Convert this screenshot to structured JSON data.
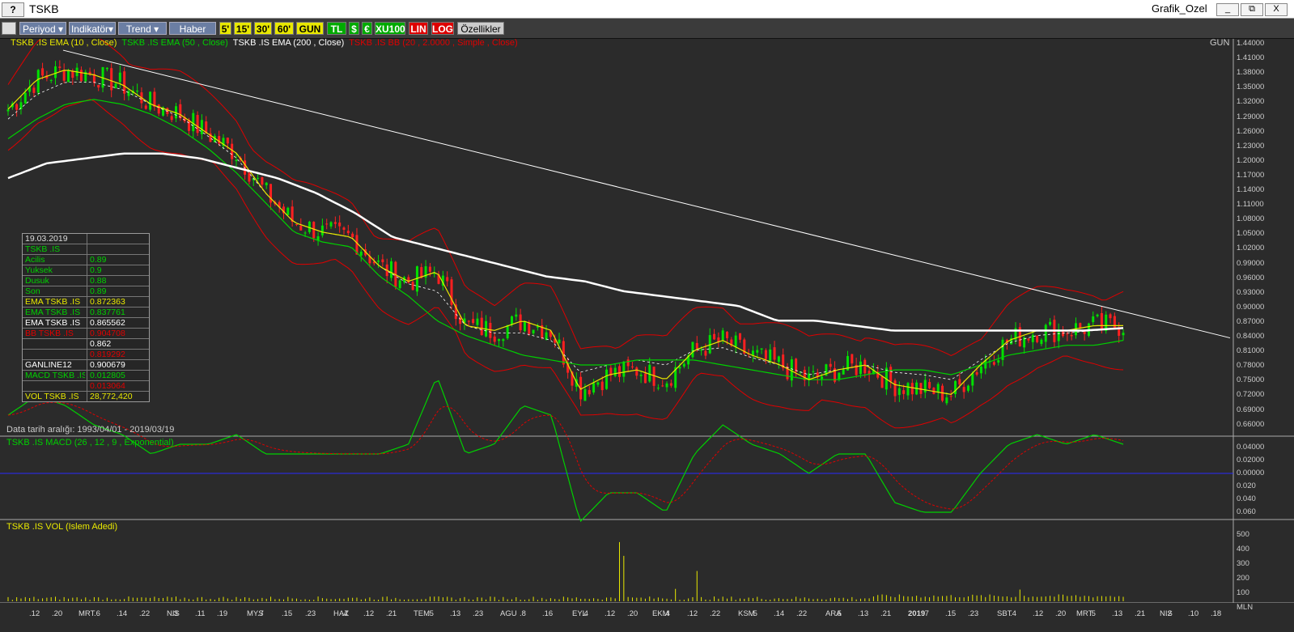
{
  "window": {
    "help_label": "?",
    "symbol": "TSKB",
    "title": "Grafik_Ozel",
    "min_label": "_",
    "restore_label": "⧉",
    "close_label": "X"
  },
  "toolbar": {
    "menus": [
      "Periyod",
      "Indikatör",
      "Trend",
      "Haber"
    ],
    "periods": [
      "5'",
      "15'",
      "30'",
      "60'",
      "GUN"
    ],
    "currencies": [
      "TL",
      "$",
      "€",
      "XU100"
    ],
    "scales": [
      "LIN",
      "LOG"
    ],
    "properties": "Özellikler"
  },
  "price_panel": {
    "legend": [
      {
        "text": "TSKB .IS EMA (10 , Close)",
        "color": "#e8e800"
      },
      {
        "text": "TSKB .IS EMA (50 , Close)",
        "color": "#00d000"
      },
      {
        "text": "TSKB .IS EMA (200 , Close)",
        "color": "#ffffff"
      },
      {
        "text": "TSKB .IS BB (20 , 2.0000 , Simple , Close)",
        "color": "#e00000"
      }
    ],
    "period_label": "GUN",
    "range_note": "Data tarih aralığı: 1993/04/01 - 2019/03/19",
    "y_ticks": [
      "1.44000",
      "1.41000",
      "1.38000",
      "1.35000",
      "1.32000",
      "1.29000",
      "1.26000",
      "1.23000",
      "1.20000",
      "1.17000",
      "1.14000",
      "1.11000",
      "1.08000",
      "1.05000",
      "1.02000",
      "0.99000",
      "0.96000",
      "0.93000",
      "0.90000",
      "0.87000",
      "0.84000",
      "0.81000",
      "0.78000",
      "0.75000",
      "0.72000",
      "0.69000",
      "0.66000"
    ]
  },
  "info_box": {
    "date": "19.03.2019",
    "symbol": "TSKB .IS",
    "rows": [
      {
        "label": "Acilis",
        "value": "0.89",
        "lc": "#00d000",
        "vc": "#00d000"
      },
      {
        "label": "Yuksek",
        "value": "0.9",
        "lc": "#00d000",
        "vc": "#00d000"
      },
      {
        "label": "Dusuk",
        "value": "0.88",
        "lc": "#00d000",
        "vc": "#00d000"
      },
      {
        "label": "Son",
        "value": "0.89",
        "lc": "#00d000",
        "vc": "#00d000"
      },
      {
        "label": "EMA TSKB .IS",
        "value": "0.872363",
        "lc": "#e8e800",
        "vc": "#e8e800"
      },
      {
        "label": "EMA TSKB .IS",
        "value": "0.837761",
        "lc": "#00d000",
        "vc": "#00d000"
      },
      {
        "label": "EMA TSKB .IS",
        "value": "0.865562",
        "lc": "#ffffff",
        "vc": "#ffffff"
      },
      {
        "label": "BB TSKB .IS",
        "value": "0.904708",
        "lc": "#e00000",
        "vc": "#e00000"
      },
      {
        "label": "",
        "value": "0.862",
        "lc": "#ffffff",
        "vc": "#ffffff"
      },
      {
        "label": "",
        "value": "0.819292",
        "lc": "#e00000",
        "vc": "#e00000"
      },
      {
        "label": "GANLINE12",
        "value": "0.900679",
        "lc": "#ffffff",
        "vc": "#ffffff"
      },
      {
        "label": "MACD TSKB .IS",
        "value": "0.012805",
        "lc": "#00d000",
        "vc": "#00d000"
      },
      {
        "label": "",
        "value": "0.013064",
        "lc": "#e00000",
        "vc": "#e00000"
      },
      {
        "label": "VOL TSKB .IS",
        "value": "28,772,420",
        "lc": "#e8e800",
        "vc": "#e8e800"
      }
    ]
  },
  "macd_panel": {
    "legend": "TSKB .IS MACD (26 , 12 , 9 , Exponential)",
    "y_ticks": [
      "0.04000",
      "0.02000",
      "0.00000",
      "0.020",
      "0.040",
      "0.060"
    ]
  },
  "volume_panel": {
    "legend": "TSKB .IS VOL (Islem Adedi)",
    "y_ticks": [
      "500",
      "400",
      "300",
      "200",
      "100",
      "MLN"
    ]
  },
  "x_axis": [
    {
      "t": ".12",
      "bold": false
    },
    {
      "t": ".20",
      "bold": false
    },
    {
      "t": "MRT",
      "bold": false
    },
    {
      "t": ".6",
      "bold": false
    },
    {
      "t": ".14",
      "bold": false
    },
    {
      "t": ".22",
      "bold": false
    },
    {
      "t": "NIS",
      "bold": false
    },
    {
      "t": ".3",
      "bold": false
    },
    {
      "t": ".11",
      "bold": false
    },
    {
      "t": ".19",
      "bold": false
    },
    {
      "t": "MYS",
      "bold": false
    },
    {
      "t": ".7",
      "bold": false
    },
    {
      "t": ".15",
      "bold": false
    },
    {
      "t": ".23",
      "bold": false
    },
    {
      "t": "HAZ",
      "bold": false
    },
    {
      "t": ".4",
      "bold": false
    },
    {
      "t": ".12",
      "bold": false
    },
    {
      "t": ".21",
      "bold": false
    },
    {
      "t": "TEM",
      "bold": false
    },
    {
      "t": ".5",
      "bold": false
    },
    {
      "t": ".13",
      "bold": false
    },
    {
      "t": ".23",
      "bold": false
    },
    {
      "t": "AGU",
      "bold": false
    },
    {
      "t": ".8",
      "bold": false
    },
    {
      "t": ".16",
      "bold": false
    },
    {
      "t": "EYL",
      "bold": false
    },
    {
      "t": ".4",
      "bold": false
    },
    {
      "t": ".12",
      "bold": false
    },
    {
      "t": ".20",
      "bold": false
    },
    {
      "t": "EKM",
      "bold": false
    },
    {
      "t": ".4",
      "bold": false
    },
    {
      "t": ".12",
      "bold": false
    },
    {
      "t": ".22",
      "bold": false
    },
    {
      "t": "KSM",
      "bold": false
    },
    {
      "t": ".5",
      "bold": false
    },
    {
      "t": ".14",
      "bold": false
    },
    {
      "t": ".22",
      "bold": false
    },
    {
      "t": "ARA",
      "bold": false
    },
    {
      "t": ".5",
      "bold": false
    },
    {
      "t": ".13",
      "bold": false
    },
    {
      "t": ".21",
      "bold": false
    },
    {
      "t": "2019",
      "bold": true
    },
    {
      "t": ".7",
      "bold": false
    },
    {
      "t": ".15",
      "bold": false
    },
    {
      "t": ".23",
      "bold": false
    },
    {
      "t": "SBT",
      "bold": false
    },
    {
      "t": ".4",
      "bold": false
    },
    {
      "t": ".12",
      "bold": false
    },
    {
      "t": ".20",
      "bold": false
    },
    {
      "t": "MRT",
      "bold": false
    },
    {
      "t": ".5",
      "bold": false
    },
    {
      "t": ".13",
      "bold": false
    },
    {
      "t": ".21",
      "bold": false
    },
    {
      "t": "NIS",
      "bold": false
    },
    {
      "t": ".2",
      "bold": false
    },
    {
      "t": ".10",
      "bold": false
    },
    {
      "t": ".18",
      "bold": false
    }
  ],
  "chart_data": {
    "type": "line",
    "title": "TSKB",
    "series": [
      {
        "name": "TSKB .IS EMA (10 , Close)",
        "color": "#e8e800",
        "values": [
          1.31,
          1.37,
          1.39,
          1.38,
          1.36,
          1.32,
          1.3,
          1.26,
          1.22,
          1.14,
          1.08,
          1.06,
          1.05,
          0.99,
          0.96,
          0.98,
          0.87,
          0.86,
          0.88,
          0.86,
          0.74,
          0.77,
          0.78,
          0.76,
          0.82,
          0.84,
          0.81,
          0.79,
          0.76,
          0.78,
          0.79,
          0.75,
          0.74,
          0.73,
          0.79,
          0.84,
          0.86,
          0.86,
          0.87,
          0.87
        ]
      },
      {
        "name": "TSKB .IS EMA (50 , Close)",
        "color": "#00d000",
        "values": [
          1.25,
          1.29,
          1.32,
          1.33,
          1.32,
          1.3,
          1.27,
          1.23,
          1.18,
          1.12,
          1.06,
          1.04,
          1.03,
          0.97,
          0.93,
          0.88,
          0.85,
          0.83,
          0.81,
          0.8,
          0.79,
          0.79,
          0.8,
          0.8,
          0.8,
          0.79,
          0.78,
          0.77,
          0.76,
          0.76,
          0.77,
          0.78,
          0.78,
          0.77,
          0.79,
          0.81,
          0.82,
          0.83,
          0.83,
          0.84
        ]
      },
      {
        "name": "TSKB .IS EMA (200 , Close)",
        "color": "#ffffff",
        "values": [
          1.17,
          1.2,
          1.21,
          1.22,
          1.22,
          1.21,
          1.19,
          1.17,
          1.14,
          1.1,
          1.05,
          1.03,
          1.01,
          0.99,
          0.97,
          0.96,
          0.94,
          0.93,
          0.92,
          0.91,
          0.88,
          0.88,
          0.87,
          0.86,
          0.86,
          0.86,
          0.86,
          0.86,
          0.86,
          0.865
        ]
      }
    ],
    "ylim": [
      0.66,
      1.44
    ],
    "grid": false,
    "legend": "top-left"
  }
}
